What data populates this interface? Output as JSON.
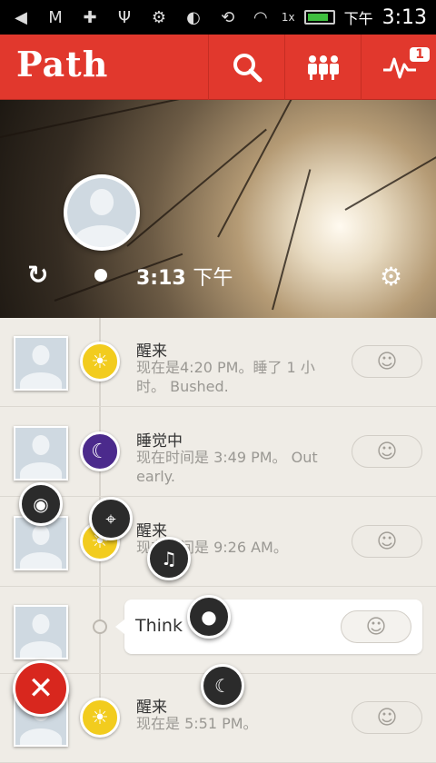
{
  "status_bar": {
    "time": "3:13",
    "period": "下午",
    "signal_text": "1x"
  },
  "app_bar": {
    "logo": "Path",
    "notification_count": "1"
  },
  "header": {
    "time": "3:13",
    "period": "下午"
  },
  "moments": [
    {
      "title": "醒来",
      "desc": "现在是4:20 PM。睡了 1 小时。 Bushed.",
      "type": "sun"
    },
    {
      "title": "睡觉中",
      "desc": "现在时间是 3:49 PM。 Out early.",
      "type": "moon"
    },
    {
      "title": "醒来",
      "desc": "现在时间是 9:26 AM。",
      "type": "sun"
    },
    {
      "title": "Think",
      "desc": "",
      "type": "thought"
    },
    {
      "title": "醒来",
      "desc": "现在是 5:51 PM。",
      "type": "sun"
    }
  ],
  "colors": {
    "brand": "#e1382d",
    "sun": "#f2cc1e",
    "moon": "#4b2a8c"
  }
}
